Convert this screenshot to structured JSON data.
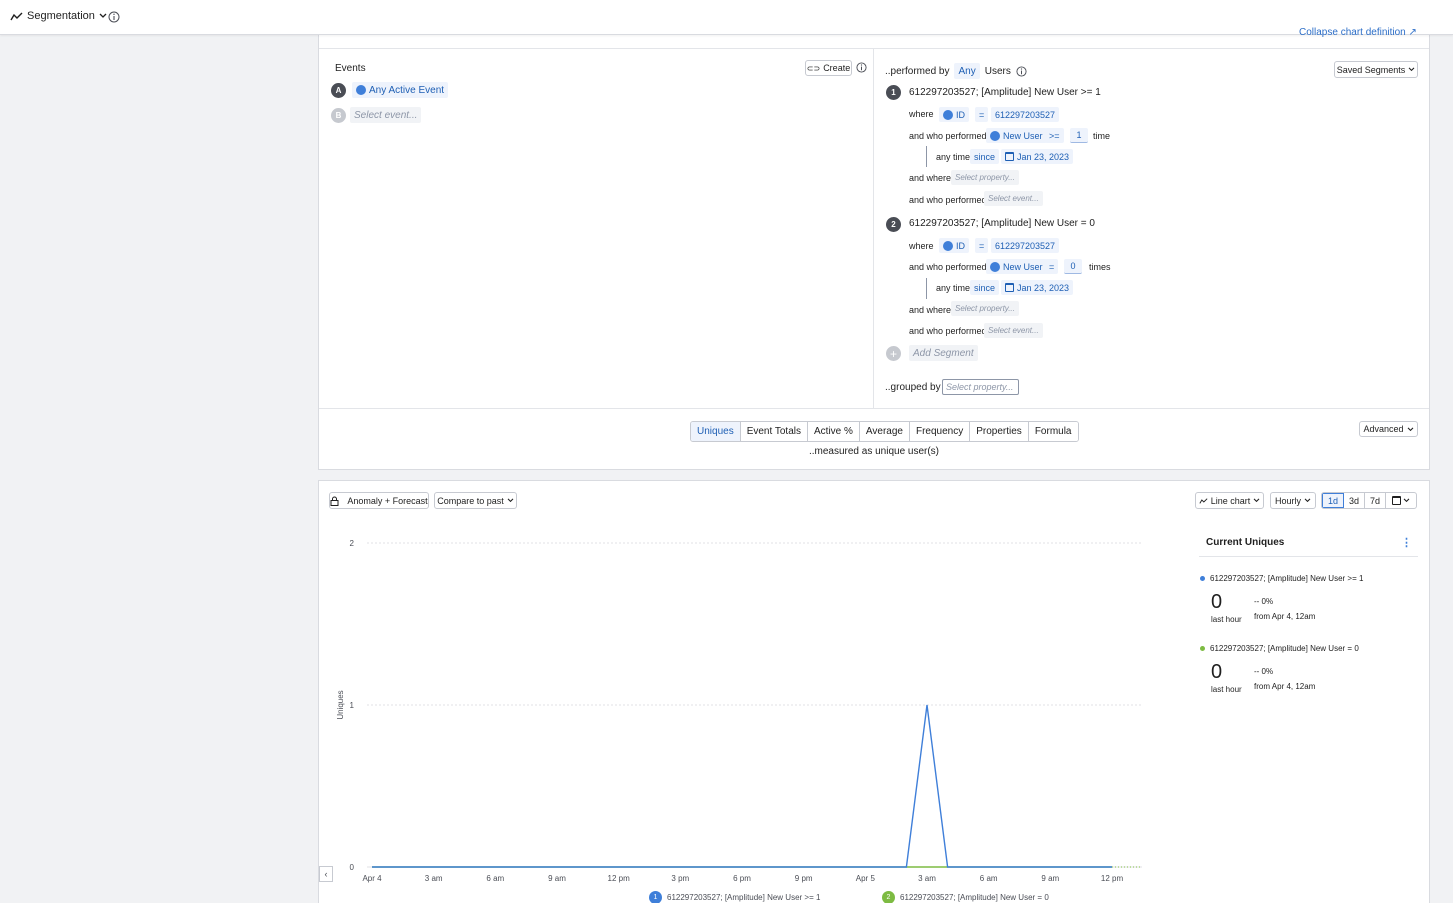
{
  "topbar": {
    "title": "Segmentation"
  },
  "definition": {
    "collapse_link": "Collapse chart definition",
    "events": {
      "title": "Events",
      "create_label": "Create",
      "items": [
        {
          "letter": "A",
          "label": "Any Active Event"
        },
        {
          "letter": "B",
          "placeholder": "Select event..."
        }
      ]
    },
    "performed": {
      "prefix": "..performed by",
      "any_label": "Any",
      "users_label": "Users",
      "saved_segments": "Saved Segments",
      "segments": [
        {
          "number": "1",
          "title": "612297203527; [Amplitude] New User >= 1",
          "where_label": "where",
          "where_prop": "ID",
          "where_op": "=",
          "where_value": "612297203527",
          "who_label": "and who performed",
          "who_event": "New User",
          "who_op": ">=",
          "who_count": "1",
          "who_unit": "time",
          "time_label": "any time",
          "since_label": "since",
          "since_date": "Jan 23, 2023",
          "and_where_label": "and where",
          "property_placeholder": "Select property...",
          "and_who_label": "and who performed",
          "event_placeholder": "Select event..."
        },
        {
          "number": "2",
          "title": "612297203527; [Amplitude] New User = 0",
          "where_label": "where",
          "where_prop": "ID",
          "where_op": "=",
          "where_value": "612297203527",
          "who_label": "and who performed",
          "who_event": "New User",
          "who_op": "=",
          "who_count": "0",
          "who_unit": "times",
          "time_label": "any time",
          "since_label": "since",
          "since_date": "Jan 23, 2023",
          "and_where_label": "and where",
          "property_placeholder": "Select property...",
          "and_who_label": "and who performed",
          "event_placeholder": "Select event..."
        }
      ],
      "add_segment": "Add Segment",
      "grouped_by": "..grouped by",
      "grouped_placeholder": "Select property..."
    },
    "measure_tabs": [
      "Uniques",
      "Event Totals",
      "Active %",
      "Average",
      "Frequency",
      "Properties",
      "Formula"
    ],
    "active_tab": "Uniques",
    "measured_as": "..measured as unique user(s)",
    "advanced": "Advanced"
  },
  "chart_panel": {
    "anomaly_btn": "Anomaly + Forecast",
    "compare_btn": "Compare to past",
    "chart_type_btn": "Line chart",
    "interval_btn": "Hourly",
    "range_options": [
      "1d",
      "3d",
      "7d"
    ],
    "active_range": "1d",
    "legend": [
      {
        "number": "1",
        "label": "612297203527; [Amplitude] New User >= 1",
        "color": "#3f7fd9"
      },
      {
        "number": "2",
        "label": "612297203527; [Amplitude] New User = 0",
        "color": "#7dbb42"
      }
    ],
    "sidebar": {
      "title": "Current Uniques",
      "items": [
        {
          "label": "612297203527; [Amplitude] New User >= 1",
          "value": "0",
          "sub": "last hour",
          "change": "-- 0%",
          "from": "from Apr 4, 12am",
          "color": "#3f7fd9"
        },
        {
          "label": "612297203527; [Amplitude] New User = 0",
          "value": "0",
          "sub": "last hour",
          "change": "-- 0%",
          "from": "from Apr 4, 12am",
          "color": "#7dbb42"
        }
      ]
    }
  },
  "chart_data": {
    "type": "line",
    "ylabel": "Uniques",
    "ylim": [
      0,
      2
    ],
    "yticks": [
      "0",
      "1",
      "2"
    ],
    "x": [
      "Apr 4 12am",
      "1am",
      "2am",
      "3am",
      "4am",
      "5am",
      "6am",
      "7am",
      "8am",
      "9am",
      "10am",
      "11am",
      "12pm",
      "1pm",
      "2pm",
      "3pm",
      "4pm",
      "5pm",
      "6pm",
      "7pm",
      "8pm",
      "9pm",
      "10pm",
      "11pm",
      "Apr 5 12am",
      "1am",
      "2am",
      "3am",
      "4am",
      "5am",
      "6am",
      "7am",
      "8am",
      "9am",
      "10am",
      "11am",
      "12pm"
    ],
    "xtick_labels": [
      "Apr 4",
      "3 am",
      "6 am",
      "9 am",
      "12 pm",
      "3 pm",
      "6 pm",
      "9 pm",
      "Apr 5",
      "3 am",
      "6 am",
      "9 am",
      "12 pm"
    ],
    "series": [
      {
        "name": "612297203527; [Amplitude] New User >= 1",
        "color": "#3f7fd9",
        "values": [
          0,
          0,
          0,
          0,
          0,
          0,
          0,
          0,
          0,
          0,
          0,
          0,
          0,
          0,
          0,
          0,
          0,
          0,
          0,
          0,
          0,
          0,
          0,
          0,
          0,
          0,
          0,
          1,
          0,
          0,
          0,
          0,
          0,
          0,
          0,
          0,
          0
        ]
      },
      {
        "name": "612297203527; [Amplitude] New User = 0",
        "color": "#7dbb42",
        "values": [
          0,
          0,
          0,
          0,
          0,
          0,
          0,
          0,
          0,
          0,
          0,
          0,
          0,
          0,
          0,
          0,
          0,
          0,
          0,
          0,
          0,
          0,
          0,
          0,
          0,
          0,
          0,
          0,
          0,
          0,
          0,
          0,
          0,
          0,
          0,
          0,
          0
        ]
      }
    ],
    "grid": true
  }
}
